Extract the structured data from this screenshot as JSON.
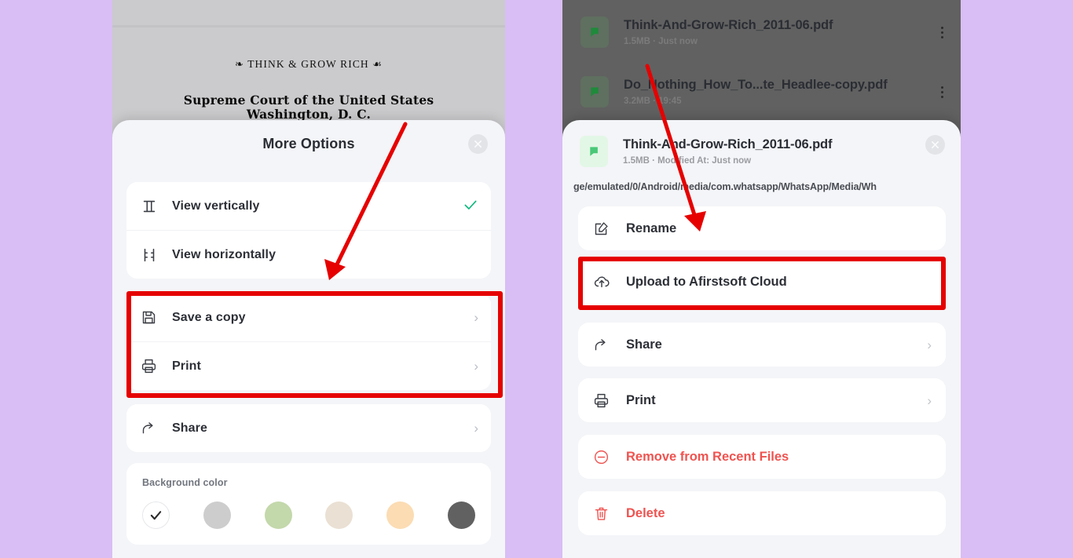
{
  "background_color": "#d9bdf5",
  "accent_red": "#e60000",
  "left_panel": {
    "document": {
      "ornament_left": "❧",
      "title": "THINK & GROW RICH",
      "ornament_right": "☙",
      "court_line1": "Supreme Court of the United States",
      "court_line2": "Washington, D. C."
    },
    "sheet_title": "More Options",
    "close_label": "close-icon",
    "view_group": [
      {
        "label": "View vertically",
        "icon": "view-vertical-icon",
        "checked": true
      },
      {
        "label": "View horizontally",
        "icon": "view-horizontal-icon",
        "checked": false
      }
    ],
    "highlighted_group": [
      {
        "label": "Save a copy",
        "icon": "floppy-disk-icon",
        "chevron": "›"
      },
      {
        "label": "Print",
        "icon": "printer-icon",
        "chevron": "›"
      }
    ],
    "share_group": [
      {
        "label": "Share",
        "icon": "share-icon",
        "chevron": "›"
      }
    ],
    "background_color_label": "Background color",
    "swatches": [
      {
        "name": "default-white",
        "color": "#ffffff",
        "selected": true
      },
      {
        "name": "gray",
        "color": "#cdcdcd",
        "selected": false
      },
      {
        "name": "green",
        "color": "#c3d8ab",
        "selected": false
      },
      {
        "name": "beige",
        "color": "#eae0d3",
        "selected": false
      },
      {
        "name": "peach",
        "color": "#fbdcb3",
        "selected": false
      },
      {
        "name": "dark-gray",
        "color": "#616161",
        "selected": false
      }
    ]
  },
  "right_panel": {
    "recent_files": [
      {
        "name": "Think-And-Grow-Rich_2011-06.pdf",
        "meta": "1.5MB · Just now"
      },
      {
        "name": "Do_Nothing_How_To...te_Headlee-copy.pdf",
        "meta": "3.2MB · 19:45"
      }
    ],
    "sheet_file": {
      "name": "Think-And-Grow-Rich_2011-06.pdf",
      "meta": "1.5MB · Modified At: Just now",
      "path": "ge/emulated/0/Android/media/com.whatsapp/WhatsApp/Media/Wh"
    },
    "close_label": "close-icon",
    "menu": [
      {
        "label": "Rename",
        "icon": "rename-icon",
        "chevron": "",
        "danger": false,
        "highlighted": false
      },
      {
        "label": "Upload to Afirstsoft Cloud",
        "icon": "cloud-upload-icon",
        "chevron": "",
        "danger": false,
        "highlighted": true
      },
      {
        "label": "Share",
        "icon": "share-icon",
        "chevron": "›",
        "danger": false,
        "highlighted": false
      },
      {
        "label": "Print",
        "icon": "printer-icon",
        "chevron": "›",
        "danger": false,
        "highlighted": false
      },
      {
        "label": "Remove from Recent Files",
        "icon": "remove-circle-icon",
        "chevron": "",
        "danger": true,
        "highlighted": false
      },
      {
        "label": "Delete",
        "icon": "trash-icon",
        "chevron": "",
        "danger": true,
        "highlighted": false
      }
    ]
  }
}
